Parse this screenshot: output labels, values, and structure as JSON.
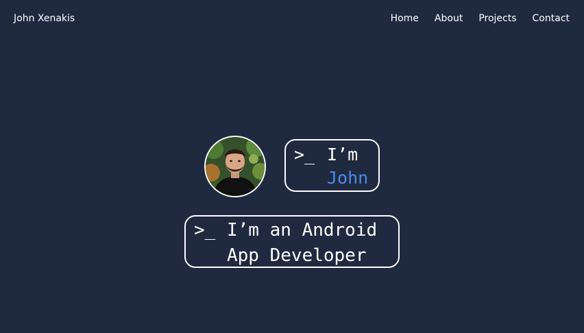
{
  "header": {
    "brand": "John Xenakis",
    "nav": [
      {
        "label": "Home"
      },
      {
        "label": "About"
      },
      {
        "label": "Projects"
      },
      {
        "label": "Contact"
      }
    ]
  },
  "hero": {
    "prompt_symbol": ">_",
    "intro_line": "I’m",
    "name": "John",
    "role_line1": "I’m an Android",
    "role_line2": "App Developer"
  },
  "colors": {
    "background": "#1f2940",
    "accent": "#4a8be8",
    "text": "#ffffff"
  }
}
